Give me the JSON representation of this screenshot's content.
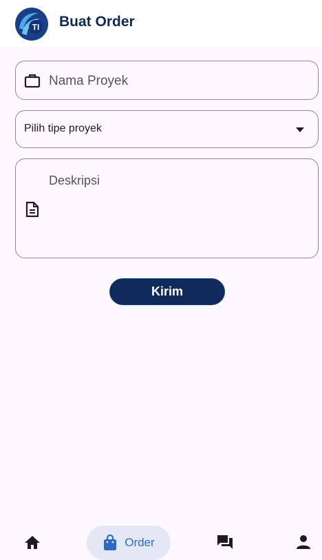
{
  "app": {
    "title": "Buat Order",
    "logo_text": "TI",
    "brand_color": "#0d2a57"
  },
  "form": {
    "project_name": {
      "placeholder": "Nama Proyek",
      "icon": "briefcase-icon"
    },
    "project_type": {
      "selected": "Pilih tipe proyek",
      "icon": "dropdown-arrow-icon"
    },
    "description": {
      "placeholder": "Deskripsi",
      "icon": "document-icon"
    },
    "submit_label": "Kirim"
  },
  "nav": {
    "items": [
      {
        "label": "",
        "icon": "home-icon"
      },
      {
        "label": "Order",
        "icon": "shopping-bag-icon",
        "active": true
      },
      {
        "label": "",
        "icon": "chat-icon"
      },
      {
        "label": "",
        "icon": "person-icon"
      }
    ]
  }
}
